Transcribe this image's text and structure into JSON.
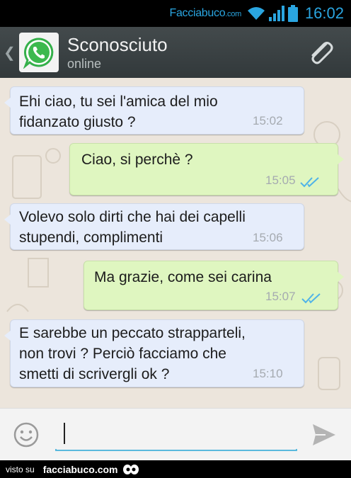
{
  "status_bar": {
    "brand_name": "Facciabuco",
    "brand_suffix": ".com",
    "time": "16:02",
    "icons": [
      "wifi-icon",
      "signal-icon",
      "battery-icon"
    ]
  },
  "header": {
    "back_glyph": "❮",
    "contact_name": "Sconosciuto",
    "status": "online",
    "avatar_icon": "whatsapp-logo",
    "action_icon": "paperclip-icon"
  },
  "messages": [
    {
      "direction": "in",
      "text": "Ehi ciao, tu sei l'amica del mio\nfidanzato giusto ?",
      "time": "15:02",
      "read": false
    },
    {
      "direction": "out",
      "text": "Ciao, si perchè ?",
      "time": "15:05",
      "read": true
    },
    {
      "direction": "in",
      "text": "Volevo solo dirti che hai dei capelli\nstupendi, complimenti",
      "time": "15:06",
      "read": false
    },
    {
      "direction": "out",
      "text": "Ma grazie, come sei carina",
      "time": "15:07",
      "read": true
    },
    {
      "direction": "in",
      "text": "E sarebbe un peccato strapparteli,\nnon trovi ? Perciò facciamo che\nsmetti di scrivergli ok ?",
      "time": "15:10",
      "read": false
    }
  ],
  "input": {
    "value": "",
    "emoji_icon": "smiley-icon",
    "send_icon": "send-icon"
  },
  "footer": {
    "visto_label": "visto su",
    "site": "facciabuco.com"
  },
  "colors": {
    "incoming_bubble": "#e6edfb",
    "outgoing_bubble": "#dff6c0",
    "read_ticks": "#4fb3e8",
    "brand_blue": "#2aa5e0",
    "header_bg": "#3a4143"
  }
}
